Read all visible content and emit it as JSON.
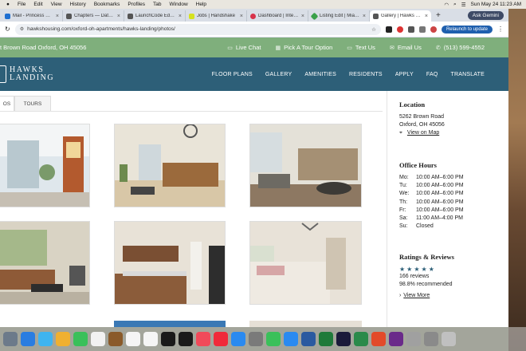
{
  "menubar": {
    "items": [
      "File",
      "Edit",
      "View",
      "History",
      "Bookmarks",
      "Profiles",
      "Tab",
      "Window",
      "Help"
    ],
    "datetime": "Sun May 24  11:23 AM"
  },
  "tabs": [
    {
      "title": "Mail - Princess Nwosu",
      "color": "#1f6fd1"
    },
    {
      "title": "Chapters — Data Ana",
      "color": "#444"
    },
    {
      "title": "LaunchCode Educatio",
      "color": "#444"
    },
    {
      "title": "Jobs | Handshake",
      "color": "#d6e21f"
    },
    {
      "title": "Dashboard | Interstr",
      "color": "#d8324a"
    },
    {
      "title": "Listing Edit | Miami U",
      "color": "#3aa14a"
    },
    {
      "title": "Gallery | Hawks Land",
      "color": "#555",
      "active": true
    }
  ],
  "browser": {
    "new_tab": "+",
    "ask": "Ask Gemini",
    "url": "hawkshousing.com/oxford-oh-apartments/hawks-landing/photos/",
    "relaunch": "Relaunch to update"
  },
  "site": {
    "address": "t Brown Road Oxford, OH 45056",
    "live_chat": "Live Chat",
    "tour": "Pick A Tour Option",
    "text_us": "Text Us",
    "email_us": "Email Us",
    "phone": "(513) 599-4552",
    "logo_line1": "HAWKS",
    "logo_line2": "LANDING",
    "nav": [
      "FLOOR PLANS",
      "GALLERY",
      "AMENITIES",
      "RESIDENTS",
      "APPLY",
      "FAQ",
      "TRANSLATE"
    ]
  },
  "gallery": {
    "tab_photos": "OS",
    "tab_tours": "TOURS",
    "photos": [
      {
        "alt": "lobby-popcorn-machine",
        "colors": [
          "#dfe7ec",
          "#b35a2e",
          "#8a4a33"
        ]
      },
      {
        "alt": "leasing-office-desk",
        "colors": [
          "#e9e4d8",
          "#9b6a3c",
          "#d8c7a7"
        ]
      },
      {
        "alt": "clubhouse-lounge",
        "colors": [
          "#e4e1d8",
          "#6d6a63",
          "#a59074"
        ]
      },
      {
        "alt": "living-room",
        "colors": [
          "#d9d3c4",
          "#8e5a37",
          "#6b8b55"
        ]
      },
      {
        "alt": "kitchen",
        "colors": [
          "#e8e2d7",
          "#7a4f33",
          "#3c3c3c"
        ]
      },
      {
        "alt": "bedroom",
        "colors": [
          "#e8e2d8",
          "#cfc4b2",
          "#d6a6a6"
        ]
      }
    ]
  },
  "sidebar": {
    "location_title": "Location",
    "street": "5262 Brown Road",
    "city": "Oxford, OH 45056",
    "map_link": "View on Map",
    "hours_title": "Office Hours",
    "hours": [
      {
        "d": "Mo:",
        "h": "10:00 AM–6:00 PM"
      },
      {
        "d": "Tu:",
        "h": "10:00 AM–6:00 PM"
      },
      {
        "d": "We:",
        "h": "10:00 AM–6:00 PM"
      },
      {
        "d": "Th:",
        "h": "10:00 AM–6:00 PM"
      },
      {
        "d": "Fr:",
        "h": "10:00 AM–6:00 PM"
      },
      {
        "d": "Sa:",
        "h": "11:00 AM–4:00 PM"
      },
      {
        "d": "Su:",
        "h": "Closed"
      }
    ],
    "ratings_title": "Ratings & Reviews",
    "stars": "★★★★★",
    "reviews": "166 reviews",
    "recommended": "98.8% recommended",
    "view_more": "View More"
  },
  "dock": [
    "#6c7a8a",
    "#2a7de1",
    "#3fb4f0",
    "#f0b030",
    "#3ac05a",
    "#f2f2f2",
    "#8a5a2a",
    "#f5f5f5",
    "#f5f5f5",
    "#1a1a1a",
    "#1a1a1a",
    "#f04a5a",
    "#f02a3a",
    "#2a8af0",
    "#7a7a7a",
    "#3ac05a",
    "#2a8af0",
    "#2a5aa0",
    "#1e7a3a",
    "#1a1a3a",
    "#2a8a4a",
    "#e24a2a",
    "#6a2a8a",
    "#a0a0a0",
    "#8a8a8a",
    "#c0c0c0"
  ]
}
